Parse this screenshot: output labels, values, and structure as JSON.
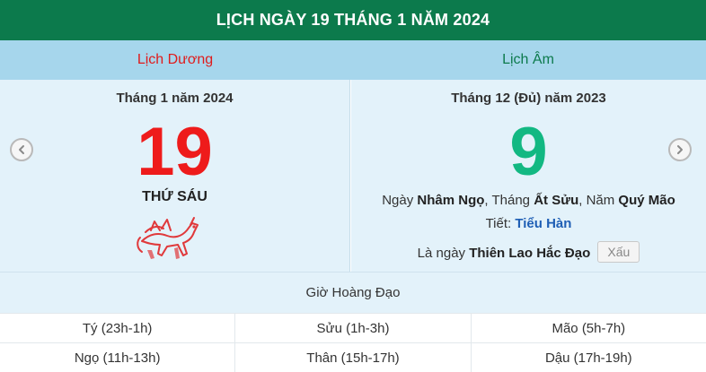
{
  "title": "LỊCH NGÀY 19 THÁNG 1 NĂM 2024",
  "solar": {
    "header": "Lịch Dương",
    "month_year": "Tháng 1 năm 2024",
    "day": "19",
    "weekday": "THỨ SÁU"
  },
  "lunar": {
    "header": "Lịch Âm",
    "month_year": "Tháng 12 (Đủ) năm 2023",
    "day": "9",
    "ngay_label": "Ngày",
    "ngay_value": "Nhâm Ngọ",
    "thang_label": ", Tháng",
    "thang_value": "Ất Sửu",
    "nam_label": ", Năm",
    "nam_value": "Quý Mão",
    "tiet_label": "Tiết:",
    "tiet_value": "Tiểu Hàn",
    "la_ngay_label": "Là ngày",
    "la_ngay_value": "Thiên Lao Hắc Đạo",
    "rating": "Xấu"
  },
  "gio_hoang_dao": {
    "header": "Giờ Hoàng Đạo",
    "rows": [
      [
        "Tý (23h-1h)",
        "Sửu (1h-3h)",
        "Mão (5h-7h)"
      ],
      [
        "Ngọ (11h-13h)",
        "Thân (15h-17h)",
        "Dậu (17h-19h)"
      ]
    ]
  },
  "icons": {
    "prev": "chevron-left-icon",
    "next": "chevron-right-icon",
    "zodiac": "horse-icon"
  },
  "colors": {
    "title_bg": "#0c7a4c",
    "header_bg": "#a6d6ec",
    "panel_bg": "#e3f2fa",
    "solar_red": "#ee1b1b",
    "lunar_green": "#12b882",
    "tiet_blue": "#1f5fb5"
  }
}
